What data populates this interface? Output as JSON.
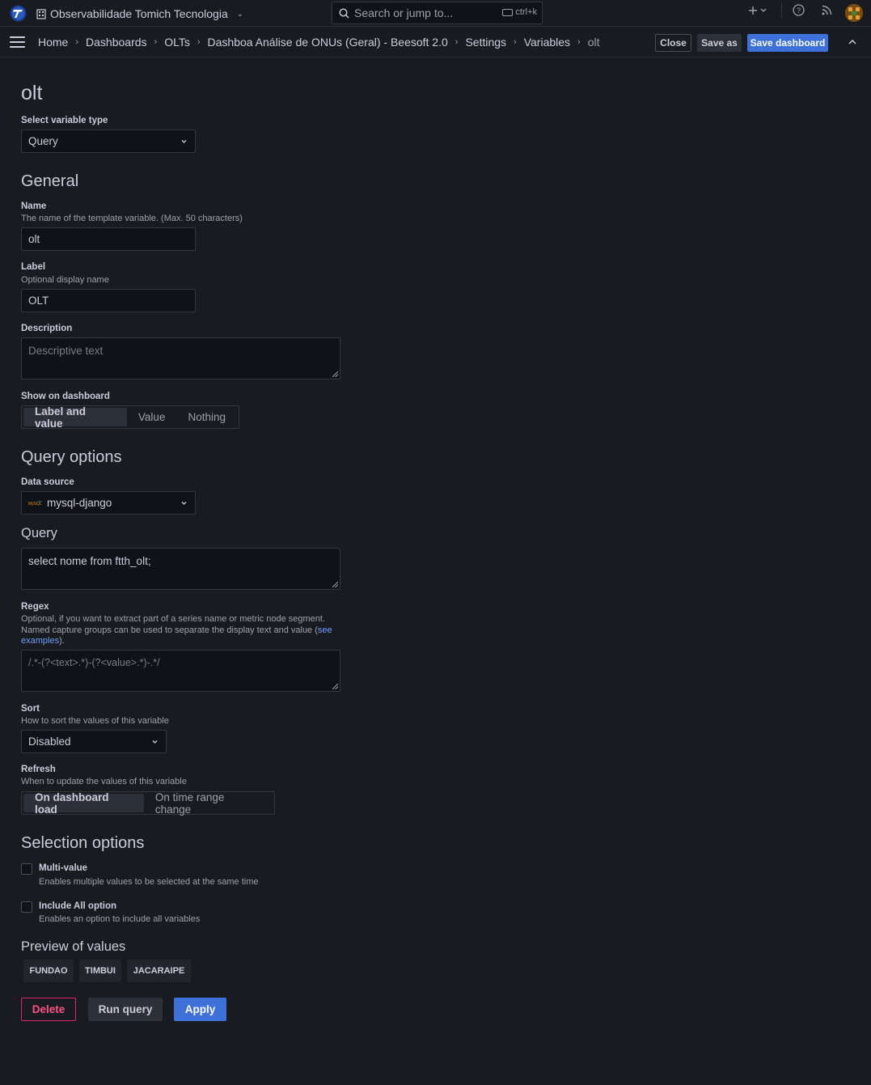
{
  "topbar": {
    "org_name": "Observabilidade Tomich Tecnologia",
    "search_placeholder": "Search or jump to...",
    "search_shortcut": "ctrl+k",
    "plus_icon": "plus-icon",
    "help_icon": "help-icon",
    "news_icon": "rss-icon"
  },
  "breadcrumbs": [
    "Home",
    "Dashboards",
    "OLTs",
    "Dashboa Análise de ONUs (Geral) - Beesoft 2.0",
    "Settings",
    "Variables",
    "olt"
  ],
  "actions": {
    "close": "Close",
    "save_as": "Save as",
    "save_dashboard": "Save dashboard"
  },
  "page": {
    "title": "olt",
    "variable_type_label": "Select variable type",
    "variable_type_value": "Query"
  },
  "general": {
    "heading": "General",
    "name_label": "Name",
    "name_desc": "The name of the template variable. (Max. 50 characters)",
    "name_value": "olt",
    "label_label": "Label",
    "label_desc": "Optional display name",
    "label_value": "OLT",
    "description_label": "Description",
    "description_placeholder": "Descriptive text",
    "show_label": "Show on dashboard",
    "show_options": [
      "Label and value",
      "Value",
      "Nothing"
    ],
    "show_selected": "Label and value"
  },
  "query_options": {
    "heading": "Query options",
    "datasource_label": "Data source",
    "datasource_value": "mysql-django",
    "query_heading": "Query",
    "query_value": "select nome from ftth_olt;",
    "regex_label": "Regex",
    "regex_desc_1": "Optional, if you want to extract part of a series name or metric node segment.",
    "regex_desc_2": "Named capture groups can be used to separate the display text and value (",
    "regex_link_1": "see",
    "regex_link_2": "examples",
    "regex_desc_end": ").",
    "regex_placeholder": "/.*-(?<text>.*)-(?<value>.*)-.*/",
    "sort_label": "Sort",
    "sort_desc": "How to sort the values of this variable",
    "sort_value": "Disabled",
    "refresh_label": "Refresh",
    "refresh_desc": "When to update the values of this variable",
    "refresh_options": [
      "On dashboard load",
      "On time range change"
    ],
    "refresh_selected": "On dashboard load"
  },
  "selection_options": {
    "heading": "Selection options",
    "multi_label": "Multi-value",
    "multi_desc": "Enables multiple values to be selected at the same time",
    "multi_checked": false,
    "all_label": "Include All option",
    "all_desc": "Enables an option to include all variables",
    "all_checked": false
  },
  "preview": {
    "heading": "Preview of values",
    "values": [
      "FUNDAO",
      "TIMBUI",
      "JACARAIPE"
    ]
  },
  "footer": {
    "delete": "Delete",
    "run_query": "Run query",
    "apply": "Apply"
  },
  "colors": {
    "background": "#181b1f",
    "primary": "#3d71d9",
    "danger": "#e0226e",
    "link": "#6e9fff"
  }
}
